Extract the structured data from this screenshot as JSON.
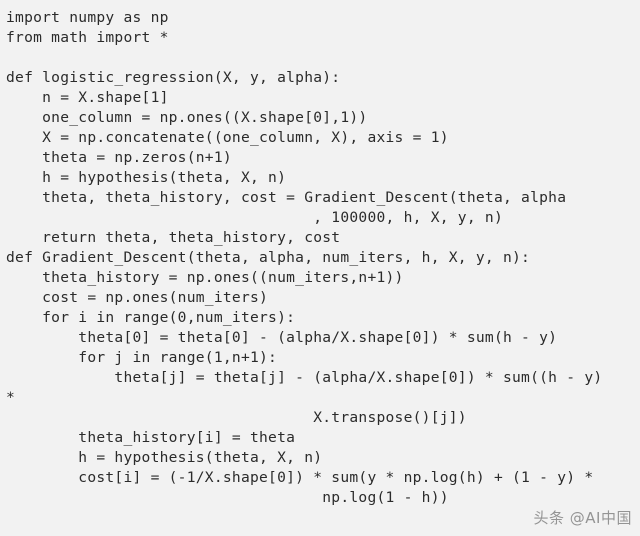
{
  "window": {
    "background_color": "#f2f2f2",
    "text_color": "#2b2b2b",
    "language": "python"
  },
  "code": {
    "lines": [
      "import numpy as np",
      "from math import *",
      "",
      "def logistic_regression(X, y, alpha):",
      "    n = X.shape[1]",
      "    one_column = np.ones((X.shape[0],1))",
      "    X = np.concatenate((one_column, X), axis = 1)",
      "    theta = np.zeros(n+1)",
      "    h = hypothesis(theta, X, n)",
      "    theta, theta_history, cost = Gradient_Descent(theta, alpha",
      "                                  , 100000, h, X, y, n)",
      "    return theta, theta_history, cost",
      "def Gradient_Descent(theta, alpha, num_iters, h, X, y, n):",
      "    theta_history = np.ones((num_iters,n+1))",
      "    cost = np.ones(num_iters)",
      "    for i in range(0,num_iters):",
      "        theta[0] = theta[0] - (alpha/X.shape[0]) * sum(h - y)",
      "        for j in range(1,n+1):",
      "            theta[j] = theta[j] - (alpha/X.shape[0]) * sum((h - y)",
      "*",
      "                                  X.transpose()[j])",
      "        theta_history[i] = theta",
      "        h = hypothesis(theta, X, n)",
      "        cost[i] = (-1/X.shape[0]) * sum(y * np.log(h) + (1 - y) *",
      "                                   np.log(1 - h))"
    ]
  },
  "watermark": {
    "text": "头条 @AI中国",
    "color": "#8f8f8f"
  }
}
